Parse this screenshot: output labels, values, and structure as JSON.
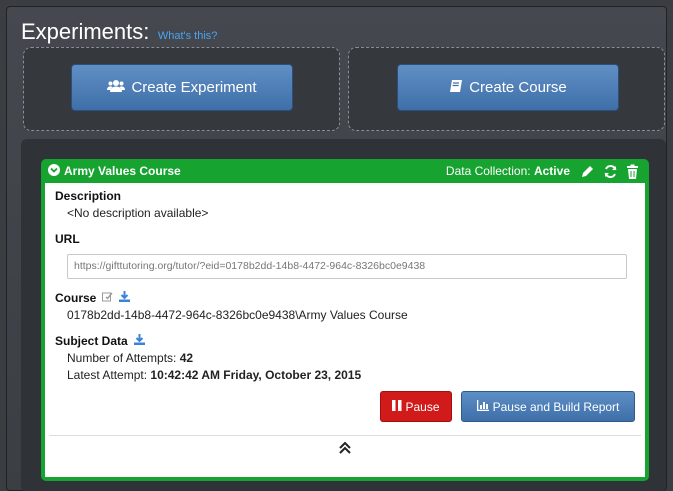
{
  "header": {
    "title": "Experiments:",
    "whats_this": "What's this?"
  },
  "actions": {
    "create_experiment": "Create Experiment",
    "create_course": "Create Course"
  },
  "experiment": {
    "name": "Army Values Course",
    "data_collection_label": "Data Collection:",
    "data_collection_status": "Active",
    "description_label": "Description",
    "description": "<No description available>",
    "url_label": "URL",
    "url": "https://gifttutoring.org/tutor/?eid=0178b2dd-14b8-4472-964c-8326bc0e9438",
    "course_label": "Course",
    "course_path": "0178b2dd-14b8-4472-964c-8326bc0e9438\\Army Values Course",
    "subject_data_label": "Subject Data",
    "attempts_label": "Number of Attempts:",
    "attempts": "42",
    "latest_label": "Latest Attempt:",
    "latest": "10:42:42 AM Friday, October 23, 2015",
    "pause_label": "Pause",
    "pause_build_label": "Pause and Build Report"
  },
  "colors": {
    "active": "#17a32f",
    "pause": "#d11a1a",
    "primary": "#4a7bb5",
    "link": "#4aa3f0"
  }
}
